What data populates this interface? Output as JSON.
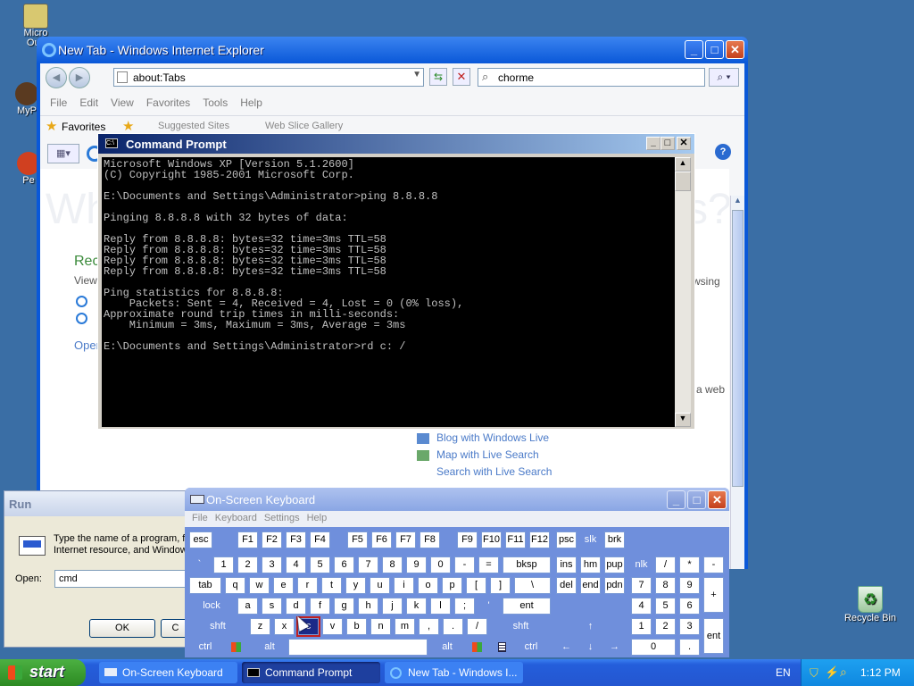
{
  "desktop": {
    "icons": [
      {
        "label": "Micro\nOutl"
      },
      {
        "label": "MyP"
      },
      {
        "label": "Pe"
      },
      {
        "label": "Recycle Bin"
      }
    ]
  },
  "ie": {
    "title": "New Tab - Windows Internet Explorer",
    "address": "about:Tabs",
    "search": "chorme",
    "menu": [
      "File",
      "Edit",
      "View",
      "Favorites",
      "Tools",
      "Help"
    ],
    "favorites_label": "Favorites",
    "suggested_sites": "Suggested Sites",
    "web_slice": "Web Slice Gallery",
    "content": {
      "heading_left": "Wh",
      "heading_right": "s?",
      "reopen": "Rec",
      "view": "View",
      "open": "Open",
      "browsing": "wsing",
      "a_web": "a web",
      "accel_items": [
        "Blog with Windows Live",
        "Map with Live Search",
        "Search with Live Search"
      ]
    }
  },
  "cmd": {
    "title": "Command Prompt",
    "lines": [
      "Microsoft Windows XP [Version 5.1.2600]",
      "(C) Copyright 1985-2001 Microsoft Corp.",
      "",
      "E:\\Documents and Settings\\Administrator>ping 8.8.8.8",
      "",
      "Pinging 8.8.8.8 with 32 bytes of data:",
      "",
      "Reply from 8.8.8.8: bytes=32 time=3ms TTL=58",
      "Reply from 8.8.8.8: bytes=32 time=3ms TTL=58",
      "Reply from 8.8.8.8: bytes=32 time=3ms TTL=58",
      "Reply from 8.8.8.8: bytes=32 time=3ms TTL=58",
      "",
      "Ping statistics for 8.8.8.8:",
      "    Packets: Sent = 4, Received = 4, Lost = 0 (0% loss),",
      "Approximate round trip times in milli-seconds:",
      "    Minimum = 3ms, Maximum = 3ms, Average = 3ms",
      "",
      "E:\\Documents and Settings\\Administrator>rd c: /"
    ]
  },
  "run": {
    "title": "Run",
    "description_1": "Type the name of a program, f",
    "description_2": "Internet resource, and Window",
    "open_label": "Open:",
    "open_value": "cmd",
    "ok": "OK",
    "cancel": "C"
  },
  "osk": {
    "title": "On-Screen Keyboard",
    "menu": [
      "File",
      "Keyboard",
      "Settings",
      "Help"
    ],
    "keys": {
      "esc": "esc",
      "f1": "F1",
      "f2": "F2",
      "f3": "F3",
      "f4": "F4",
      "f5": "F5",
      "f6": "F6",
      "f7": "F7",
      "f8": "F8",
      "f9": "F9",
      "f10": "F10",
      "f11": "F11",
      "f12": "F12",
      "psc": "psc",
      "slk": "slk",
      "brk": "brk",
      "grave": "`",
      "n1": "1",
      "n2": "2",
      "n3": "3",
      "n4": "4",
      "n5": "5",
      "n6": "6",
      "n7": "7",
      "n8": "8",
      "n9": "9",
      "n0": "0",
      "minus": "-",
      "equals": "=",
      "bksp": "bksp",
      "ins": "ins",
      "hm": "hm",
      "pup": "pup",
      "nlk": "nlk",
      "slash": "/",
      "star": "*",
      "pminus": "-",
      "tab": "tab",
      "q": "q",
      "w": "w",
      "e": "e",
      "r": "r",
      "t": "t",
      "y": "y",
      "u": "u",
      "i": "i",
      "o": "o",
      "p": "p",
      "lbr": "[",
      "rbr": "]",
      "bslash": "\\",
      "del": "del",
      "end": "end",
      "pdn": "pdn",
      "p7": "7",
      "p8": "8",
      "p9": "9",
      "plus": "+",
      "lock": "lock",
      "a": "a",
      "s": "s",
      "d": "d",
      "f": "f",
      "g": "g",
      "h": "h",
      "j": "j",
      "k": "k",
      "l": "l",
      "semi": ";",
      "quote": "'",
      "ent": "ent",
      "p4": "4",
      "p5": "5",
      "p6": "6",
      "shft": "shft",
      "z": "z",
      "x": "x",
      "c": "c",
      "v": "v",
      "b": "b",
      "n": "n",
      "m": "m",
      "comma": ",",
      "period": ".",
      "fslash": "/",
      "shft2": "shft",
      "p1": "1",
      "p2": "2",
      "p3": "3",
      "pent": "ent",
      "ctrl": "ctrl",
      "alt": "alt",
      "alt2": "alt",
      "ctrl2": "ctrl",
      "p0": "0",
      "pdot": "."
    }
  },
  "taskbar": {
    "start": "start",
    "items": [
      "On-Screen Keyboard",
      "Command Prompt",
      "New Tab - Windows I..."
    ],
    "lang": "EN",
    "clock": "1:12 PM"
  },
  "colors": {
    "desktop": "#3a6ea5",
    "xp_title": "#0a58d8",
    "taskbar": "#245edb",
    "start": "#3a9a2e"
  }
}
